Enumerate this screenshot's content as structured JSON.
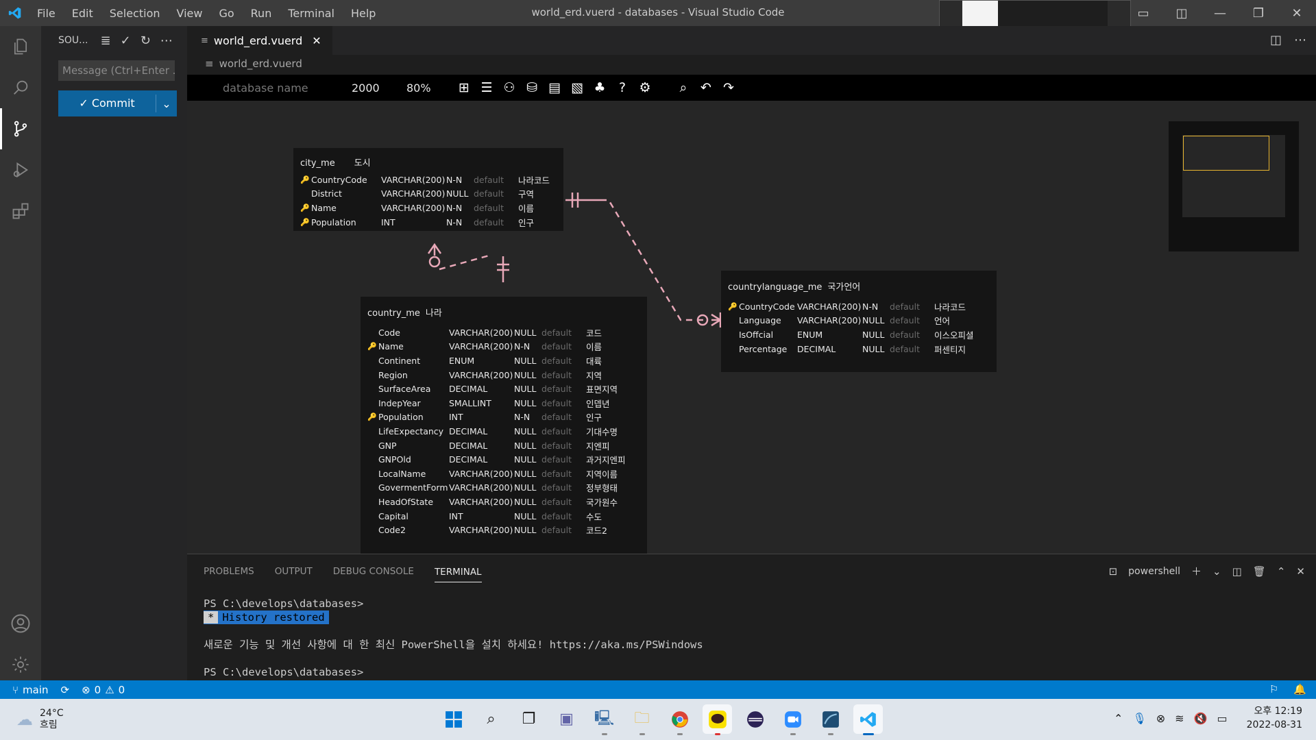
{
  "window": {
    "title": "world_erd.vuerd - databases - Visual Studio Code",
    "menu": [
      "File",
      "Edit",
      "Selection",
      "View",
      "Go",
      "Run",
      "Terminal",
      "Help"
    ]
  },
  "sidebar": {
    "title": "SOU...",
    "message_placeholder": "Message (Ctrl+Enter ...",
    "commit_label": "Commit"
  },
  "editor": {
    "tab_label": "world_erd.vuerd",
    "breadcrumb": "world_erd.vuerd"
  },
  "erd": {
    "database_placeholder": "database name",
    "width": "2000",
    "zoom": "80%",
    "tables": [
      {
        "name": "city_me",
        "comment": "도시",
        "columns": [
          {
            "pk": true,
            "name": "CountryCode",
            "type": "VARCHAR(200)",
            "null": "N-N",
            "default": "default",
            "comment": "나라코드"
          },
          {
            "pk": false,
            "name": "District",
            "type": "VARCHAR(200)",
            "null": "NULL",
            "default": "default",
            "comment": "구역"
          },
          {
            "pk": true,
            "name": "Name",
            "type": "VARCHAR(200)",
            "null": "N-N",
            "default": "default",
            "comment": "이름"
          },
          {
            "pk": true,
            "name": "Population",
            "type": "INT",
            "null": "N-N",
            "default": "default",
            "comment": "인구"
          }
        ]
      },
      {
        "name": "country_me",
        "comment": "나라",
        "columns": [
          {
            "pk": false,
            "name": "Code",
            "type": "VARCHAR(200)",
            "null": "NULL",
            "default": "default",
            "comment": "코드"
          },
          {
            "pk": true,
            "name": "Name",
            "type": "VARCHAR(200)",
            "null": "N-N",
            "default": "default",
            "comment": "이름"
          },
          {
            "pk": false,
            "name": "Continent",
            "type": "ENUM",
            "null": "NULL",
            "default": "default",
            "comment": "대륙"
          },
          {
            "pk": false,
            "name": "Region",
            "type": "VARCHAR(200)",
            "null": "NULL",
            "default": "default",
            "comment": "지역"
          },
          {
            "pk": false,
            "name": "SurfaceArea",
            "type": "DECIMAL",
            "null": "NULL",
            "default": "default",
            "comment": "표면지역"
          },
          {
            "pk": false,
            "name": "IndepYear",
            "type": "SMALLINT",
            "null": "NULL",
            "default": "default",
            "comment": "인뎁년"
          },
          {
            "pk": true,
            "name": "Population",
            "type": "INT",
            "null": "N-N",
            "default": "default",
            "comment": "인구"
          },
          {
            "pk": false,
            "name": "LifeExpectancy",
            "type": "DECIMAL",
            "null": "NULL",
            "default": "default",
            "comment": "기대수명"
          },
          {
            "pk": false,
            "name": "GNP",
            "type": "DECIMAL",
            "null": "NULL",
            "default": "default",
            "comment": "지엔피"
          },
          {
            "pk": false,
            "name": "GNPOld",
            "type": "DECIMAL",
            "null": "NULL",
            "default": "default",
            "comment": "과거지엔피"
          },
          {
            "pk": false,
            "name": "LocalName",
            "type": "VARCHAR(200)",
            "null": "NULL",
            "default": "default",
            "comment": "지역이름"
          },
          {
            "pk": false,
            "name": "GovermentForm",
            "type": "VARCHAR(200)",
            "null": "NULL",
            "default": "default",
            "comment": "정부형태"
          },
          {
            "pk": false,
            "name": "HeadOfState",
            "type": "VARCHAR(200)",
            "null": "NULL",
            "default": "default",
            "comment": "국가원수"
          },
          {
            "pk": false,
            "name": "Capital",
            "type": "INT",
            "null": "NULL",
            "default": "default",
            "comment": "수도"
          },
          {
            "pk": false,
            "name": "Code2",
            "type": "VARCHAR(200)",
            "null": "NULL",
            "default": "default",
            "comment": "코드2"
          }
        ]
      },
      {
        "name": "countrylanguage_me",
        "comment": "국가언어",
        "columns": [
          {
            "pk": true,
            "name": "CountryCode",
            "type": "VARCHAR(200)",
            "null": "N-N",
            "default": "default",
            "comment": "나라코드"
          },
          {
            "pk": false,
            "name": "Language",
            "type": "VARCHAR(200)",
            "null": "NULL",
            "default": "default",
            "comment": "언어"
          },
          {
            "pk": false,
            "name": "IsOffcial",
            "type": "ENUM",
            "null": "NULL",
            "default": "default",
            "comment": "이스오피셜"
          },
          {
            "pk": false,
            "name": "Percentage",
            "type": "DECIMAL",
            "null": "NULL",
            "default": "default",
            "comment": "퍼센티지"
          }
        ]
      }
    ]
  },
  "panel": {
    "tabs": [
      "PROBLEMS",
      "OUTPUT",
      "DEBUG CONSOLE",
      "TERMINAL"
    ],
    "shell": "powershell",
    "terminal": {
      "prompt1": "PS C:\\develops\\databases>",
      "history_star": "*",
      "history_text": "History restored",
      "notice": "새로운 기능 및 개선 사항에 대 한 최신 PowerShell을 설치 하세요! https://aka.ms/PSWindows",
      "prompt2": "PS C:\\develops\\databases>"
    }
  },
  "statusbar": {
    "branch": "main",
    "errors": "0",
    "warnings": "0"
  },
  "taskbar": {
    "temperature": "24°C",
    "weather": "흐림",
    "time": "오후 12:19",
    "date": "2022-08-31"
  },
  "colors": {
    "accent": "#007acc",
    "relation_line": "#e8a8b8",
    "pk_key": "#b5a642"
  }
}
